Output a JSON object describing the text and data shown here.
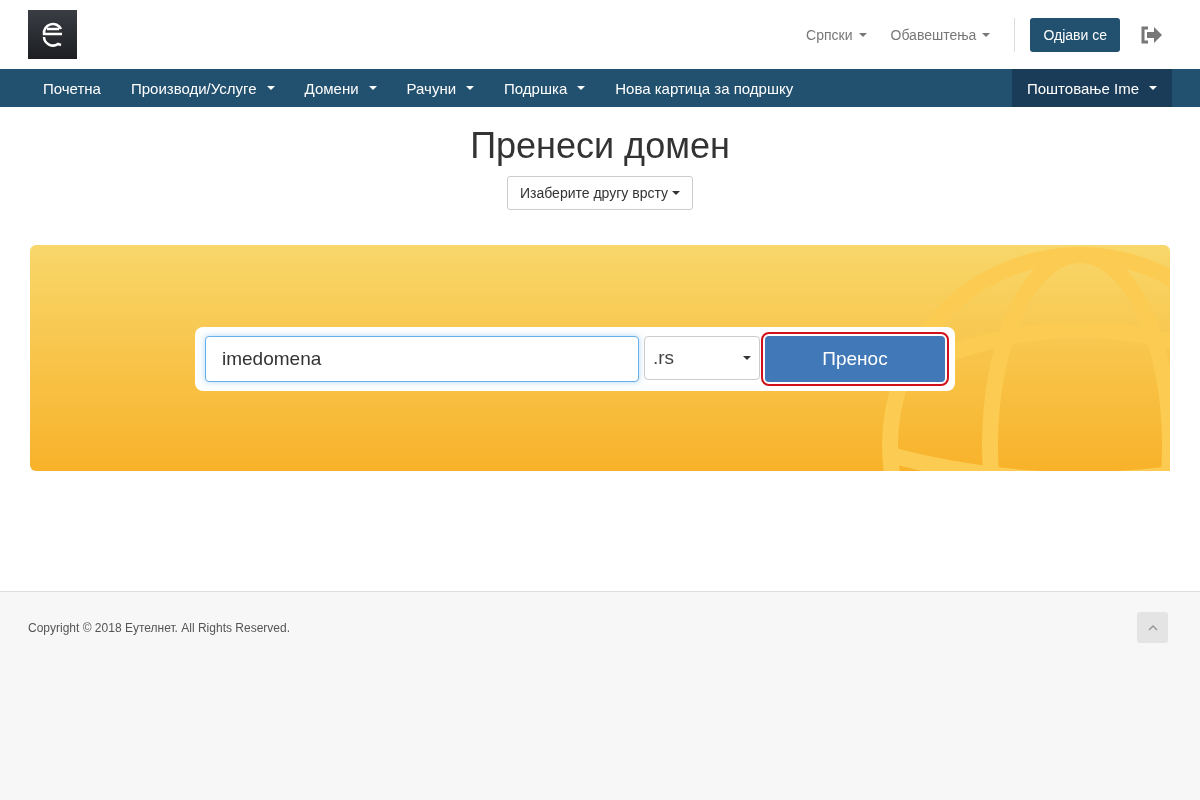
{
  "header": {
    "links": [
      {
        "label": "Српски",
        "dropdown": true
      },
      {
        "label": "Обавештења",
        "dropdown": true
      }
    ],
    "logout_button": "Одјави се"
  },
  "nav": {
    "items": [
      {
        "label": "Почетна",
        "dropdown": false
      },
      {
        "label": "Производи/Услуге",
        "dropdown": true
      },
      {
        "label": "Домени",
        "dropdown": true
      },
      {
        "label": "Рачуни",
        "dropdown": true
      },
      {
        "label": "Подршка",
        "dropdown": true
      },
      {
        "label": "Нова картица за подршку",
        "dropdown": false
      }
    ],
    "user": {
      "label": "Поштовање Ime",
      "dropdown": true
    }
  },
  "page": {
    "title": "Пренеси домен",
    "type_button": "Изаберите другу врсту"
  },
  "search": {
    "value": "imedomena",
    "tld": ".rs",
    "button": "Пренос",
    "button_highlighted": true
  },
  "footer": {
    "copyright": "Copyright © 2018 Еутелнет. All Rights Reserved."
  }
}
